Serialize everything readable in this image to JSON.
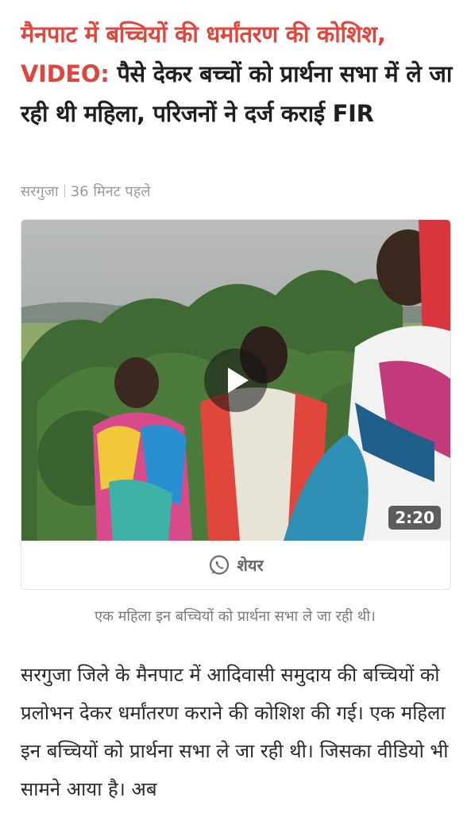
{
  "headline": {
    "highlight": "मैनपाट में बच्चियों की धर्मांतरण की कोशिश, VIDEO:",
    "rest": " पैसे देकर बच्चों को प्रार्थना सभा में ले जा रही थी महिला, परिजनों ने दर्ज कराई FIR"
  },
  "meta": {
    "location": "सरगुजा",
    "time": "36 मिनट पहले"
  },
  "video": {
    "duration": "2:20",
    "share_label": "शेयर",
    "play_icon": "play-icon",
    "share_icon": "whatsapp-icon"
  },
  "caption": "एक महिला इन बच्चियों को प्रार्थना सभा ले जा रही थी।",
  "article": {
    "paragraph": "सरगुजा जिले के मैनपाट में आदिवासी समुदाय की बच्चियों को प्रलोभन देकर धर्मांतरण कराने की कोशिश की गई। एक महिला इन बच्चियों को प्रार्थना सभा ले जा रही थी। जिसका वीडियो भी सामने आया है। अब"
  },
  "colors": {
    "accent_red": "#e2453b",
    "meta_gray": "#9a9a9a"
  }
}
